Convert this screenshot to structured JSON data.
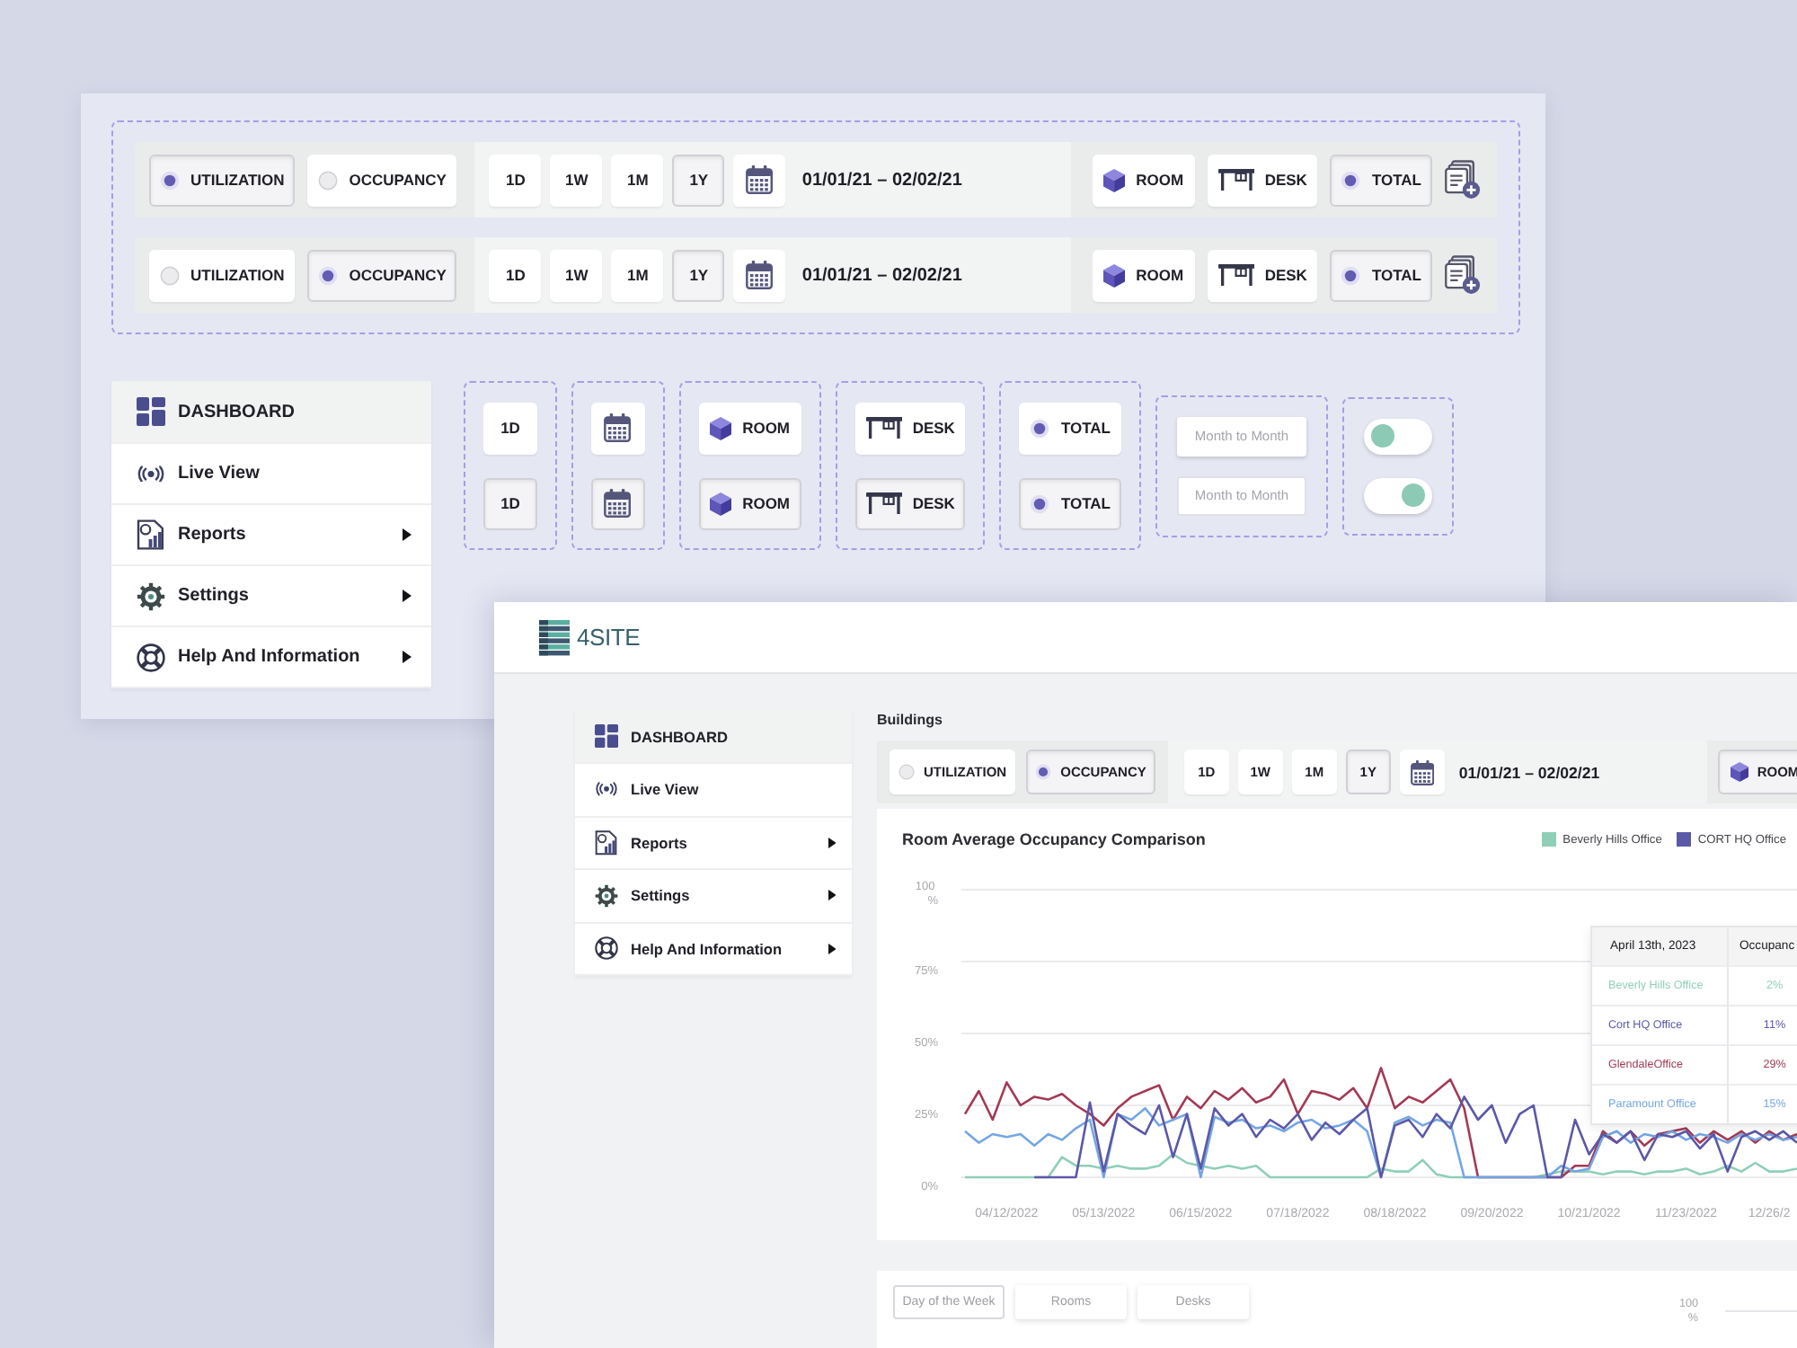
{
  "back_panel": {
    "toolbar_rows": [
      {
        "metrics": [
          {
            "label": "UTILIZATION",
            "selected": true
          },
          {
            "label": "OCCUPANCY",
            "selected": false
          }
        ],
        "periods": [
          {
            "label": "1D",
            "selected": false
          },
          {
            "label": "1W",
            "selected": false
          },
          {
            "label": "1M",
            "selected": false
          },
          {
            "label": "1Y",
            "selected": true
          }
        ],
        "date_range": "01/01/21 – 02/02/21",
        "views": [
          {
            "kind": "room",
            "label": "ROOM",
            "selected": false
          },
          {
            "kind": "desk",
            "label": "DESK",
            "selected": false
          },
          {
            "kind": "total",
            "label": "TOTAL",
            "selected": true
          }
        ]
      },
      {
        "metrics": [
          {
            "label": "UTILIZATION",
            "selected": false
          },
          {
            "label": "OCCUPANCY",
            "selected": true
          }
        ],
        "periods": [
          {
            "label": "1D",
            "selected": false
          },
          {
            "label": "1W",
            "selected": false
          },
          {
            "label": "1M",
            "selected": false
          },
          {
            "label": "1Y",
            "selected": true
          }
        ],
        "date_range": "01/01/21 – 02/02/21",
        "views": [
          {
            "kind": "room",
            "label": "ROOM",
            "selected": false
          },
          {
            "kind": "desk",
            "label": "DESK",
            "selected": false
          },
          {
            "kind": "total",
            "label": "TOTAL",
            "selected": true
          }
        ]
      }
    ],
    "sidebar": {
      "items": [
        {
          "kind": "dashboard",
          "label": "DASHBOARD",
          "selected": true,
          "submenu": false
        },
        {
          "kind": "live",
          "label": "Live View",
          "selected": false,
          "submenu": false
        },
        {
          "kind": "reports",
          "label": "Reports",
          "selected": false,
          "submenu": true
        },
        {
          "kind": "settings",
          "label": "Settings",
          "selected": false,
          "submenu": true
        },
        {
          "kind": "help",
          "label": "Help And Information",
          "selected": false,
          "submenu": true
        }
      ]
    },
    "component_states": [
      {
        "kind": "period",
        "items": [
          {
            "label": "1D",
            "selected": false
          },
          {
            "label": "1D",
            "selected": true
          }
        ]
      },
      {
        "kind": "calendar",
        "items": [
          {
            "selected": false
          },
          {
            "selected": true
          }
        ]
      },
      {
        "kind": "room",
        "items": [
          {
            "label": "ROOM",
            "selected": false
          },
          {
            "label": "ROOM",
            "selected": true
          }
        ]
      },
      {
        "kind": "desk",
        "items": [
          {
            "label": "DESK",
            "selected": false
          },
          {
            "label": "DESK",
            "selected": true
          }
        ]
      },
      {
        "kind": "total",
        "items": [
          {
            "label": "TOTAL",
            "selected": false
          },
          {
            "label": "TOTAL",
            "selected": true
          }
        ]
      },
      {
        "kind": "option",
        "items": [
          {
            "label": "Month to Month",
            "selected": false
          },
          {
            "label": "Month to Month",
            "selected": true
          }
        ]
      },
      {
        "kind": "toggle",
        "items": [
          {
            "on": false
          },
          {
            "on": true
          }
        ]
      }
    ]
  },
  "app": {
    "logo": {
      "text": "4SITE"
    },
    "sidebar": {
      "items": [
        {
          "kind": "dashboard",
          "label": "DASHBOARD",
          "selected": true,
          "submenu": false
        },
        {
          "kind": "live",
          "label": "Live View",
          "selected": false,
          "submenu": false
        },
        {
          "kind": "reports",
          "label": "Reports",
          "selected": false,
          "submenu": true
        },
        {
          "kind": "settings",
          "label": "Settings",
          "selected": false,
          "submenu": true
        },
        {
          "kind": "help",
          "label": "Help And Information",
          "selected": false,
          "submenu": true
        }
      ]
    },
    "section_title": "Buildings",
    "toolbar": {
      "metrics": [
        {
          "label": "UTILIZATION",
          "selected": false
        },
        {
          "label": "OCCUPANCY",
          "selected": true
        }
      ],
      "periods": [
        {
          "label": "1D",
          "selected": false
        },
        {
          "label": "1W",
          "selected": false
        },
        {
          "label": "1M",
          "selected": false
        },
        {
          "label": "1Y",
          "selected": true
        }
      ],
      "date_range": "01/01/21 – 02/02/21",
      "views": [
        {
          "kind": "room",
          "label": "ROOM",
          "selected": true
        }
      ]
    },
    "chart_card": {
      "title": "Room Average Occupancy Comparison",
      "legend": [
        {
          "label": "Beverly Hills Office",
          "color": "#8fcfb8"
        },
        {
          "label": "CORT HQ Office",
          "color": "#5c58a8"
        }
      ],
      "chart_data": {
        "type": "line",
        "grid": true,
        "categories": [
          null,
          null,
          null,
          "04/12/2022",
          null,
          null,
          null,
          null,
          null,
          null,
          "05/13/2022",
          null,
          null,
          null,
          null,
          null,
          null,
          "06/15/2022",
          null,
          null,
          null,
          null,
          null,
          null,
          "07/18/2022",
          null,
          null,
          null,
          null,
          null,
          null,
          "08/18/2022",
          null,
          null,
          null,
          null,
          null,
          null,
          "09/20/2022",
          null,
          null,
          null,
          null,
          null,
          null,
          "10/21/2022",
          null,
          null,
          null,
          null,
          null,
          null,
          "11/23/2022",
          null,
          null,
          null,
          null,
          null,
          "12/26/2",
          null,
          null
        ],
        "ylim": [
          0,
          100
        ],
        "yticks": [
          {
            "value": 0,
            "label": "0%"
          },
          {
            "value": 25,
            "label": "25%"
          },
          {
            "value": 50,
            "label": "50%"
          },
          {
            "value": 75,
            "label": "75%"
          },
          {
            "value": 100,
            "label": "100 %"
          }
        ],
        "series": [
          {
            "color": "#8fcfb8",
            "values": [
              0,
              0,
              0,
              0,
              0,
              0,
              0,
              7,
              4,
              4,
              3,
              4,
              3,
              3,
              4,
              8,
              5,
              4,
              3,
              4,
              3,
              4,
              0,
              0,
              0,
              0,
              0,
              0,
              0,
              0,
              3,
              2,
              2,
              6,
              1,
              0,
              0,
              0,
              0,
              0,
              0,
              0,
              1,
              2,
              2,
              2,
              1,
              2,
              2,
              1,
              2,
              2,
              3,
              1,
              2,
              4,
              2,
              5,
              2,
              2,
              3
            ]
          },
          {
            "color": "#a33a55",
            "values": [
              22,
              30,
              20,
              33,
              25,
              28,
              27,
              29,
              25,
              22,
              18,
              24,
              28,
              30,
              32,
              20,
              28,
              24,
              30,
              27,
              31,
              26,
              28,
              34,
              22,
              30,
              29,
              27,
              31,
              24,
              38,
              24,
              28,
              26,
              30,
              34,
              24,
              0,
              0,
              0,
              0,
              0,
              0,
              0,
              4,
              4,
              16,
              12,
              16,
              11,
              15,
              16,
              17,
              12,
              16,
              13,
              16,
              12,
              16,
              13,
              15
            ]
          },
          {
            "color": "#74a6e4",
            "values": [
              16,
              12,
              15,
              14,
              15,
              11,
              15,
              13,
              17,
              20,
              0,
              22,
              20,
              24,
              18,
              20,
              22,
              0,
              21,
              19,
              20,
              17,
              18,
              16,
              19,
              20,
              17,
              18,
              20,
              16,
              0,
              19,
              21,
              18,
              20,
              19,
              0,
              0,
              0,
              0,
              0,
              0,
              0,
              4,
              2,
              3,
              14,
              16,
              12,
              15,
              14,
              16,
              13,
              15,
              14,
              12,
              15,
              13,
              15,
              13,
              14
            ]
          },
          {
            "color": "#5c58a8",
            "values": [
              null,
              null,
              null,
              null,
              null,
              0,
              0,
              0,
              0,
              26,
              2,
              22,
              18,
              15,
              25,
              7,
              22,
              3,
              24,
              18,
              22,
              14,
              20,
              17,
              22,
              13,
              19,
              15,
              20,
              24,
              0,
              18,
              20,
              14,
              22,
              17,
              28,
              20,
              25,
              12,
              22,
              25,
              0,
              0,
              20,
              8,
              15,
              12,
              16,
              6,
              15,
              14,
              16,
              10,
              15,
              2,
              14,
              16,
              13,
              16,
              12
            ]
          }
        ]
      },
      "tooltip": {
        "date": "April 13th, 2023",
        "column": "Occupanc",
        "rows": [
          {
            "label": "Beverly Hills Office",
            "value": "2%",
            "color": "#8fcfb8"
          },
          {
            "label": "Cort HQ Office",
            "value": "11%",
            "color": "#5c58a8"
          },
          {
            "label": "GlendaleOffice",
            "value": "29%",
            "color": "#a33a55"
          },
          {
            "label": "Paramount Office",
            "value": "15%",
            "color": "#74a6e4"
          }
        ]
      }
    },
    "bottom_card": {
      "tabs": [
        {
          "label": "Day of the Week",
          "selected": true
        },
        {
          "label": "Rooms",
          "selected": false
        },
        {
          "label": "Desks",
          "selected": false
        }
      ],
      "axis_label": "100 %"
    }
  }
}
